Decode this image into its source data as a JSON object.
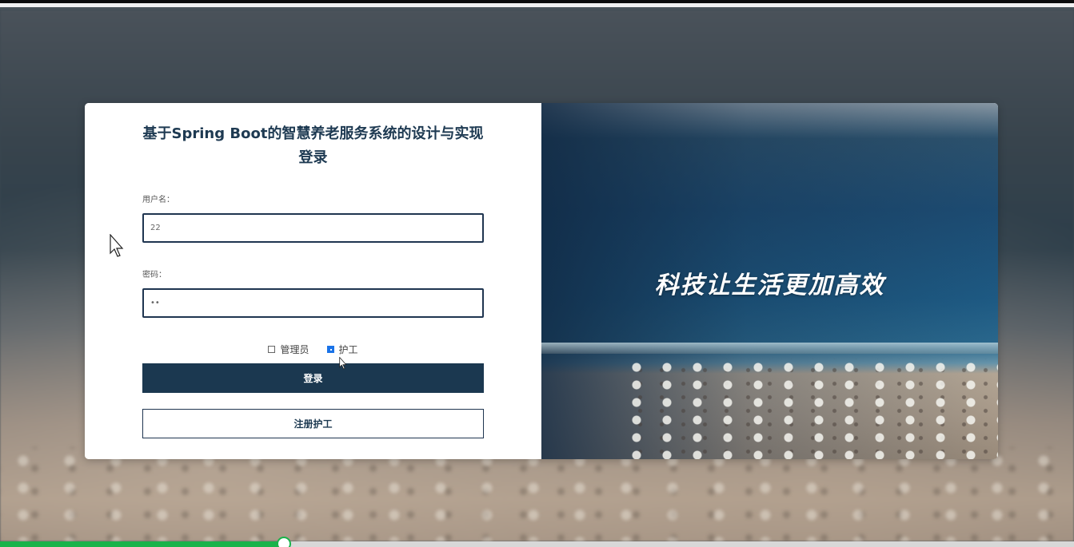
{
  "login": {
    "title_line1": "基于Spring Boot的智慧养老服务系统的设计与实现",
    "title_line2": "登录",
    "username_label": "用户名：",
    "username_value": "22",
    "password_label": "密码：",
    "password_value": "••",
    "roles": [
      {
        "label": "管理员",
        "checked": false
      },
      {
        "label": "护工",
        "checked": true
      }
    ],
    "login_button": "登录",
    "register_button": "注册护工"
  },
  "banner": {
    "slogan": "科技让生活更加高效"
  },
  "player": {
    "progress": 0.264,
    "accent": "#19b34a"
  },
  "colors": {
    "primary": "#1b3850",
    "checkbox_checked": "#1a73e8"
  }
}
